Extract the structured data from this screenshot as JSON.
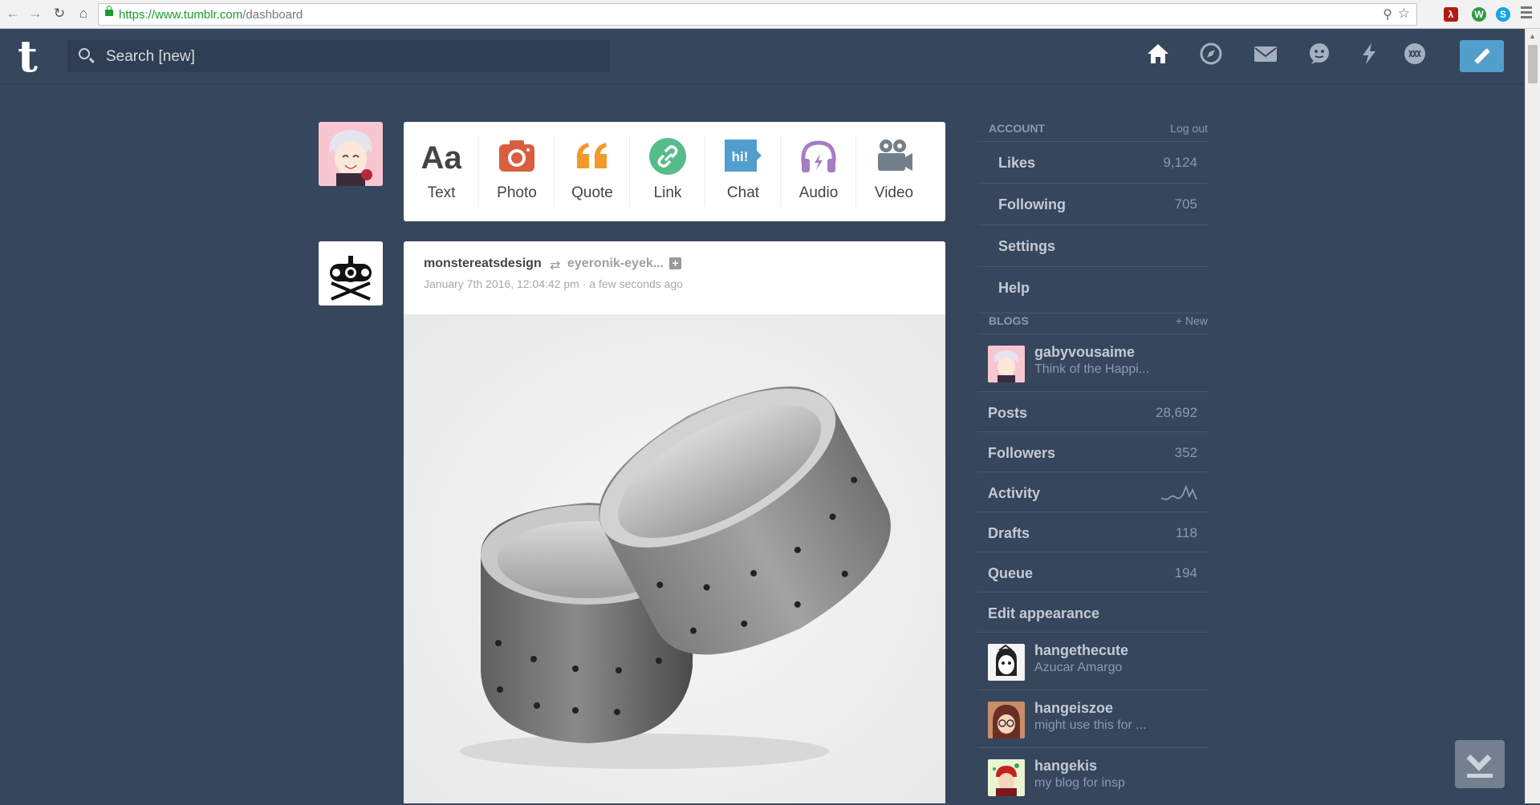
{
  "browser": {
    "url_host": "https://www.tumblr.com",
    "url_path": "/dashboard"
  },
  "header": {
    "logo": "t",
    "search_placeholder": "Search [new]",
    "nav_icons": [
      "home-icon",
      "explore-icon",
      "inbox-icon",
      "messaging-icon",
      "activity-icon",
      "account-icon"
    ],
    "accent_color": "#529ecc",
    "background_color": "#36465d"
  },
  "post_types": [
    {
      "label": "Text",
      "icon": "text-icon",
      "color": "#444444"
    },
    {
      "label": "Photo",
      "icon": "camera-icon",
      "color": "#d95e40"
    },
    {
      "label": "Quote",
      "icon": "quote-icon",
      "color": "#f2992e"
    },
    {
      "label": "Link",
      "icon": "link-icon",
      "color": "#56bc8a"
    },
    {
      "label": "Chat",
      "icon": "chat-icon",
      "color": "#529ecc"
    },
    {
      "label": "Audio",
      "icon": "headphones-icon",
      "color": "#a77dc2"
    },
    {
      "label": "Video",
      "icon": "video-camera-icon",
      "color": "#748089"
    }
  ],
  "post": {
    "blog_name": "monstereatsdesign",
    "reblogged_from": "eyeronik-eyek...",
    "timestamp": "January 7th 2016, 12:04:42 pm",
    "relative_time": "a few seconds ago"
  },
  "sidebar": {
    "account_title": "ACCOUNT",
    "logout": "Log out",
    "account_items": [
      {
        "label": "Likes",
        "value": "9,124"
      },
      {
        "label": "Following",
        "value": "705"
      },
      {
        "label": "Settings",
        "value": ""
      },
      {
        "label": "Help",
        "value": ""
      }
    ],
    "blogs_title": "BLOGS",
    "new_blog": "+ New",
    "primary_blog": {
      "name": "gabyvousaime",
      "desc": "Think of the Happi..."
    },
    "blog_stats": [
      {
        "label": "Posts",
        "value": "28,692"
      },
      {
        "label": "Followers",
        "value": "352"
      },
      {
        "label": "Activity",
        "value": ""
      },
      {
        "label": "Drafts",
        "value": "118"
      },
      {
        "label": "Queue",
        "value": "194"
      },
      {
        "label": "Edit appearance",
        "value": ""
      }
    ],
    "other_blogs": [
      {
        "name": "hangethecute",
        "desc": "Azucar Amargo"
      },
      {
        "name": "hangeiszoe",
        "desc": "might use this for ..."
      },
      {
        "name": "hangekis",
        "desc": "my blog for insp"
      }
    ]
  }
}
